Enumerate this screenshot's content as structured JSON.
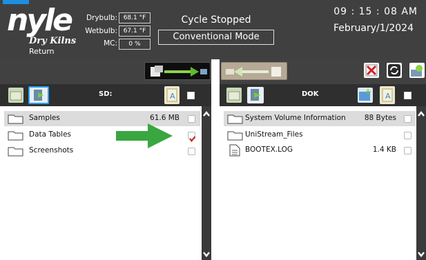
{
  "header": {
    "logo_text": "nyle",
    "logo_subtitle": "Dry Kilns",
    "logo_return": "Return",
    "readings": [
      {
        "label": "Drybulb:",
        "value": "68.1 °F"
      },
      {
        "label": "Wetbulb:",
        "value": "67.1 °F"
      },
      {
        "label": "MC:",
        "value": "0 %"
      }
    ],
    "cycle_status": "Cycle Stopped",
    "mode": "Conventional Mode",
    "time": "09 : 15 : 08  AM",
    "date": "February/1/2024"
  },
  "left_pane": {
    "title": "SD:",
    "files": [
      {
        "name": "Samples",
        "size": "61.6 MB",
        "checked": false,
        "selected": true,
        "type": "folder"
      },
      {
        "name": "Data Tables",
        "size": "",
        "checked": true,
        "selected": false,
        "type": "folder"
      },
      {
        "name": "Screenshots",
        "size": "",
        "checked": false,
        "selected": false,
        "type": "folder"
      }
    ]
  },
  "right_pane": {
    "title": "DOK",
    "files": [
      {
        "name": "System Volume Information",
        "size": "88 Bytes",
        "checked": false,
        "selected": true,
        "type": "folder"
      },
      {
        "name": "UniStream_Files",
        "size": "",
        "checked": false,
        "selected": false,
        "type": "folder"
      },
      {
        "name": "BOOTEX.LOG",
        "size": "1.4 KB",
        "checked": false,
        "selected": false,
        "type": "file"
      }
    ]
  },
  "icons": {
    "copy_to_usb": "copy-to-usb-icon",
    "copy_to_sd": "copy-to-sd-icon",
    "delete": "delete-icon",
    "refresh": "refresh-icon",
    "usb_device": "usb-device-icon",
    "annotation_arrow": "green-arrow-icon"
  },
  "colors": {
    "header_bg": "#404040",
    "check_mark": "#d02020",
    "arrow_green": "#3aa640",
    "accent_blue": "#1e8fe0"
  }
}
